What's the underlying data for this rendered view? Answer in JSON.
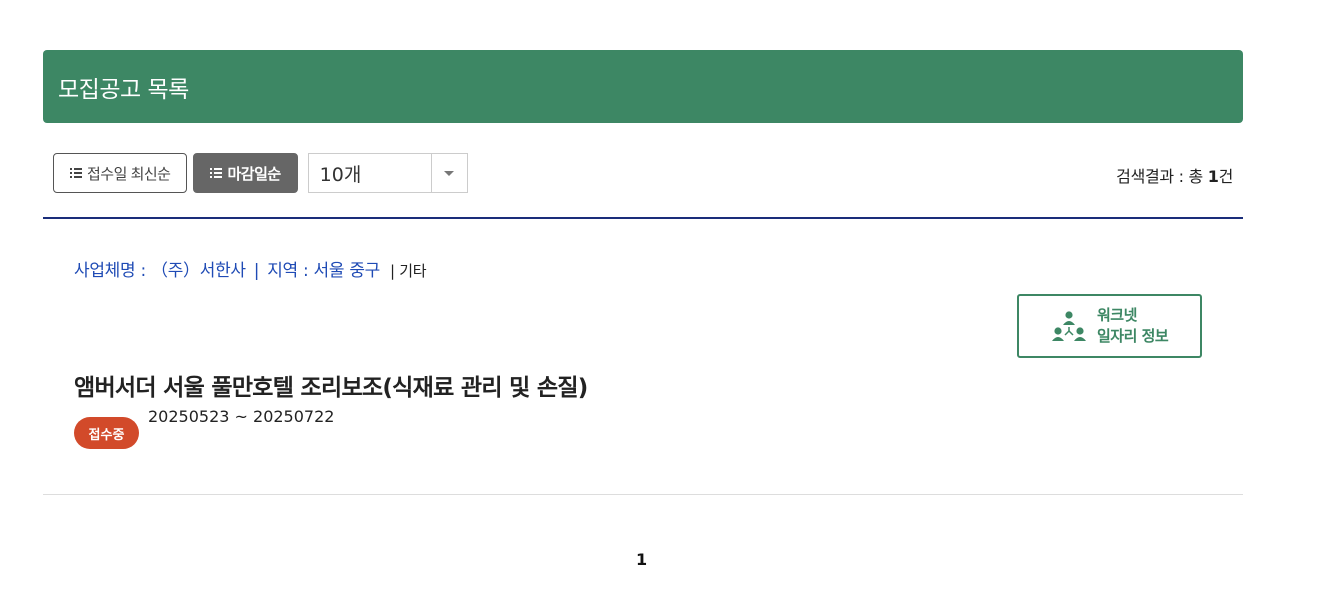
{
  "header": {
    "title": "모집공고 목록"
  },
  "toolbar": {
    "sort_receipt_label": "접수일 최신순",
    "sort_deadline_label": "마감일순",
    "page_size_value": "10개",
    "list_icon": "list-icon",
    "dropdown_icon": "caret-down-icon"
  },
  "results": {
    "label": "검색결과 : 총 ",
    "count": "1",
    "unit": "건"
  },
  "job": {
    "company_label": "사업체명 : ",
    "company": "（주）서한사",
    "separator": "|",
    "region_label": "지역 : ",
    "region": "서울 중구",
    "category": "| 기타",
    "title": "앰버서더 서울 풀만호텔 조리보조(식재료 관리 및 손질)",
    "status": "접수중",
    "period": "20250523 ~ 20250722"
  },
  "worknet": {
    "line1": "워크넷",
    "line2": "일자리 정보",
    "icon": "people-network-icon"
  },
  "pagination": {
    "current": "1"
  },
  "colors": {
    "header_bg": "#3d8764",
    "link_blue": "#1f4bb5",
    "badge_red": "#d24a2a",
    "active_sort_bg": "#666666",
    "divider_navy": "#1a2d7a"
  }
}
